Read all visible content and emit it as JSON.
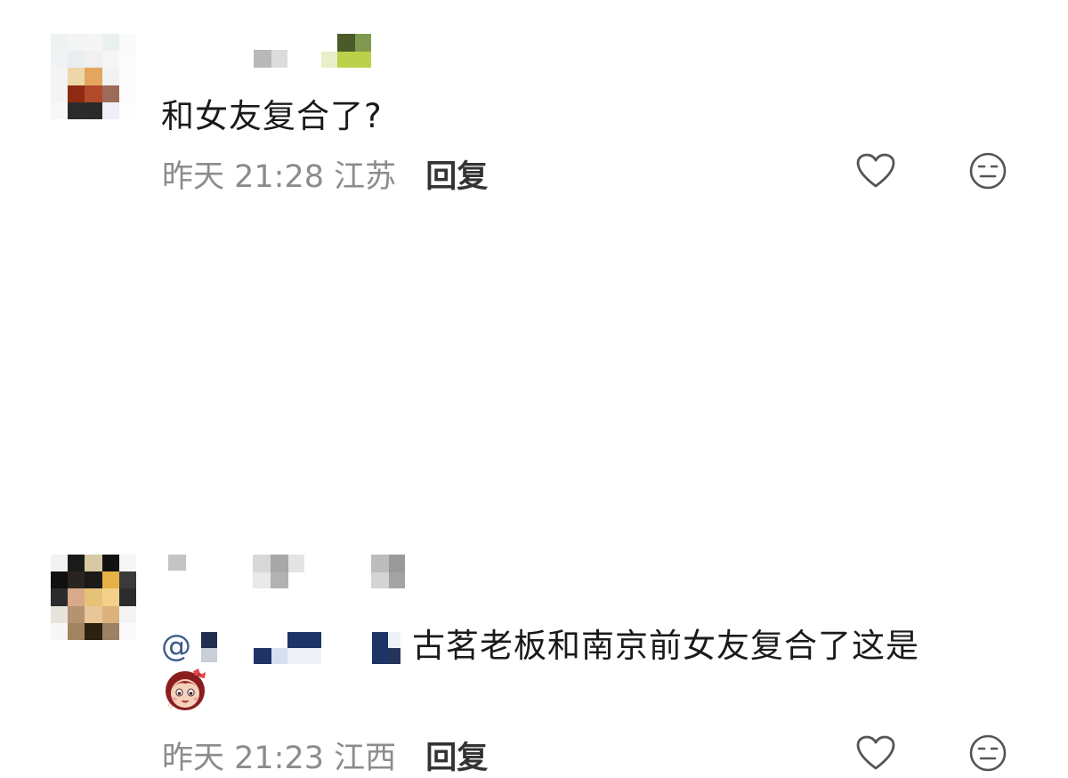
{
  "comments": [
    {
      "text": "和女友复合了?",
      "timestamp": "昨天 21:28",
      "location": "江苏",
      "reply_label": "回复",
      "like_icon": "heart-outline-icon",
      "dislike_icon": "meh-face-icon"
    },
    {
      "mention_prefix": "@",
      "text": "古茗老板和南京前女友复合了这是",
      "emoji": "girl-face-emoji",
      "timestamp": "昨天 21:23",
      "location": "江西",
      "reply_label": "回复",
      "like_icon": "heart-outline-icon",
      "dislike_icon": "meh-face-icon"
    }
  ],
  "colors": {
    "text": "#1a1a1a",
    "meta": "#8c8c8c",
    "reply": "#333333",
    "icon": "#555555",
    "mention": "#3b5a8a"
  }
}
